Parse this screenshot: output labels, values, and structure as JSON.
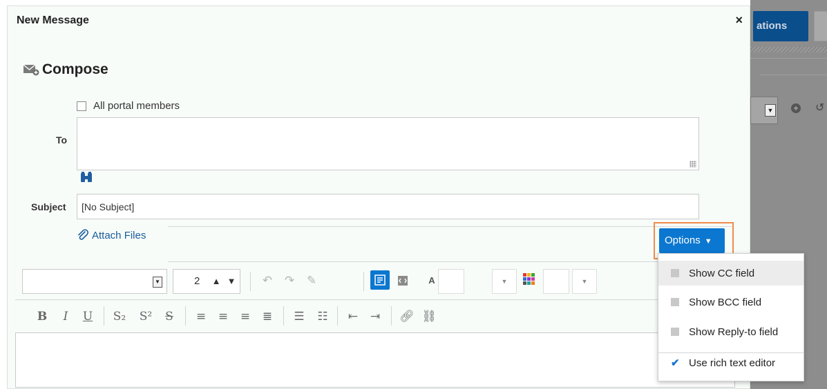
{
  "modal": {
    "title": "New Message",
    "close_label": "×"
  },
  "compose": {
    "heading": "Compose",
    "all_members_label": "All portal members",
    "to_label": "To",
    "subject_label": "Subject",
    "subject_value": "[No Subject]",
    "attach_label": "Attach Files",
    "options_label": "Options"
  },
  "toolbar": {
    "font_size_value": "2"
  },
  "options_menu": {
    "items": [
      {
        "label": "Show CC field",
        "checked": false
      },
      {
        "label": "Show BCC field",
        "checked": false
      },
      {
        "label": "Show Reply-to field",
        "checked": false
      },
      {
        "label": "Use rich text editor",
        "checked": true
      }
    ]
  },
  "background": {
    "partial_button_text": "ations"
  },
  "colors": {
    "accent": "#0c77d0",
    "highlight_frame": "#f08a4b",
    "link": "#1a5b9c"
  }
}
